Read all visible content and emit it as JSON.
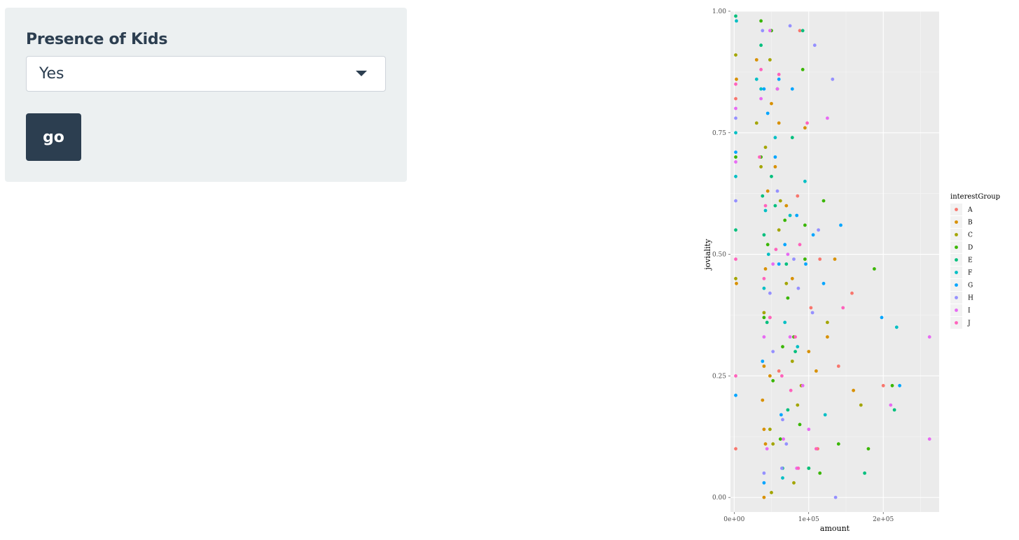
{
  "filter": {
    "label": "Presence of Kids",
    "selected": "Yes"
  },
  "go_button": {
    "label": "go"
  },
  "chart_data": {
    "type": "scatter",
    "xlabel": "amount",
    "ylabel": "joviality",
    "xlim": [
      -5000,
      275000
    ],
    "ylim": [
      -0.03,
      1.0
    ],
    "x_ticks": [
      0,
      100000,
      200000
    ],
    "x_tick_labels": [
      "0e+00",
      "1e+05",
      "2e+05"
    ],
    "y_ticks": [
      0,
      0.25,
      0.5,
      0.75,
      1.0
    ],
    "y_tick_labels": [
      "0.00",
      "0.25",
      "0.50",
      "0.75",
      "1.00"
    ],
    "grid": true,
    "legend": {
      "title": "interestGroup",
      "placement": "right"
    },
    "series": [
      {
        "name": "A",
        "color": "#F8766D",
        "points": [
          [
            2000,
            0.1
          ],
          [
            2000,
            0.82
          ],
          [
            88000,
            0.96
          ],
          [
            103000,
            0.39
          ],
          [
            112000,
            0.1
          ],
          [
            140000,
            0.27
          ],
          [
            158000,
            0.42
          ],
          [
            200000,
            0.23
          ],
          [
            48000,
            0.37
          ],
          [
            60000,
            0.26
          ],
          [
            85000,
            0.62
          ],
          [
            115000,
            0.49
          ]
        ]
      },
      {
        "name": "B",
        "color": "#D89000",
        "points": [
          [
            3000,
            0.44
          ],
          [
            3000,
            0.86
          ],
          [
            40000,
            0.0
          ],
          [
            40000,
            0.14
          ],
          [
            40000,
            0.27
          ],
          [
            42000,
            0.47
          ],
          [
            45000,
            0.63
          ],
          [
            50000,
            0.81
          ],
          [
            60000,
            0.77
          ],
          [
            70000,
            0.6
          ],
          [
            78000,
            0.45
          ],
          [
            95000,
            0.76
          ],
          [
            100000,
            0.3
          ],
          [
            110000,
            0.26
          ],
          [
            125000,
            0.33
          ],
          [
            135000,
            0.49
          ],
          [
            160000,
            0.22
          ],
          [
            42000,
            0.11
          ],
          [
            38000,
            0.2
          ],
          [
            48000,
            0.25
          ],
          [
            55000,
            0.68
          ],
          [
            30000,
            0.9
          ]
        ]
      },
      {
        "name": "C",
        "color": "#A3A500",
        "points": [
          [
            2000,
            0.45
          ],
          [
            2000,
            0.91
          ],
          [
            30000,
            0.77
          ],
          [
            36000,
            0.68
          ],
          [
            40000,
            0.38
          ],
          [
            42000,
            0.72
          ],
          [
            48000,
            0.14
          ],
          [
            50000,
            0.01
          ],
          [
            52000,
            0.11
          ],
          [
            58000,
            0.84
          ],
          [
            62000,
            0.61
          ],
          [
            70000,
            0.44
          ],
          [
            78000,
            0.28
          ],
          [
            85000,
            0.19
          ],
          [
            90000,
            0.23
          ],
          [
            125000,
            0.36
          ],
          [
            170000,
            0.19
          ],
          [
            48000,
            0.9
          ],
          [
            60000,
            0.55
          ],
          [
            80000,
            0.03
          ]
        ]
      },
      {
        "name": "D",
        "color": "#39B600",
        "points": [
          [
            2000,
            0.7
          ],
          [
            36000,
            0.98
          ],
          [
            40000,
            0.37
          ],
          [
            45000,
            0.52
          ],
          [
            50000,
            0.96
          ],
          [
            52000,
            0.24
          ],
          [
            62000,
            0.12
          ],
          [
            65000,
            0.31
          ],
          [
            72000,
            0.41
          ],
          [
            80000,
            0.33
          ],
          [
            88000,
            0.15
          ],
          [
            92000,
            0.88
          ],
          [
            95000,
            0.56
          ],
          [
            100000,
            0.06
          ],
          [
            115000,
            0.05
          ],
          [
            120000,
            0.61
          ],
          [
            140000,
            0.11
          ],
          [
            180000,
            0.1
          ],
          [
            212000,
            0.23
          ],
          [
            188000,
            0.47
          ],
          [
            36000,
            0.7
          ],
          [
            68000,
            0.57
          ],
          [
            95000,
            0.49
          ]
        ]
      },
      {
        "name": "E",
        "color": "#00BF7D",
        "points": [
          [
            2000,
            0.99
          ],
          [
            2000,
            0.55
          ],
          [
            36000,
            0.93
          ],
          [
            40000,
            0.54
          ],
          [
            44000,
            0.36
          ],
          [
            50000,
            0.66
          ],
          [
            55000,
            0.6
          ],
          [
            65000,
            0.06
          ],
          [
            72000,
            0.18
          ],
          [
            78000,
            0.74
          ],
          [
            82000,
            0.3
          ],
          [
            92000,
            0.96
          ],
          [
            100000,
            0.06
          ],
          [
            175000,
            0.05
          ],
          [
            215000,
            0.18
          ],
          [
            38000,
            0.62
          ],
          [
            70000,
            0.48
          ]
        ]
      },
      {
        "name": "F",
        "color": "#00BFC4",
        "points": [
          [
            2000,
            0.66
          ],
          [
            2000,
            0.75
          ],
          [
            3000,
            0.98
          ],
          [
            30000,
            0.86
          ],
          [
            40000,
            0.43
          ],
          [
            42000,
            0.59
          ],
          [
            46000,
            0.5
          ],
          [
            55000,
            0.74
          ],
          [
            65000,
            0.04
          ],
          [
            68000,
            0.36
          ],
          [
            75000,
            0.58
          ],
          [
            85000,
            0.31
          ],
          [
            95000,
            0.65
          ],
          [
            122000,
            0.17
          ],
          [
            218000,
            0.35
          ],
          [
            36000,
            0.84
          ]
        ]
      },
      {
        "name": "G",
        "color": "#00A5FF",
        "points": [
          [
            2000,
            0.71
          ],
          [
            2000,
            0.21
          ],
          [
            38000,
            0.28
          ],
          [
            40000,
            0.84
          ],
          [
            45000,
            0.79
          ],
          [
            55000,
            0.7
          ],
          [
            60000,
            0.48
          ],
          [
            63000,
            0.17
          ],
          [
            68000,
            0.52
          ],
          [
            78000,
            0.84
          ],
          [
            84000,
            0.58
          ],
          [
            96000,
            0.48
          ],
          [
            106000,
            0.54
          ],
          [
            120000,
            0.44
          ],
          [
            143000,
            0.56
          ],
          [
            198000,
            0.37
          ],
          [
            222000,
            0.23
          ],
          [
            40000,
            0.03
          ],
          [
            60000,
            0.86
          ]
        ]
      },
      {
        "name": "H",
        "color": "#9590FF",
        "points": [
          [
            2000,
            0.61
          ],
          [
            2000,
            0.78
          ],
          [
            38000,
            0.96
          ],
          [
            40000,
            0.05
          ],
          [
            48000,
            0.42
          ],
          [
            52000,
            0.3
          ],
          [
            58000,
            0.63
          ],
          [
            65000,
            0.16
          ],
          [
            70000,
            0.11
          ],
          [
            75000,
            0.97
          ],
          [
            80000,
            0.49
          ],
          [
            86000,
            0.43
          ],
          [
            105000,
            0.38
          ],
          [
            108000,
            0.93
          ],
          [
            113000,
            0.55
          ],
          [
            132000,
            0.86
          ],
          [
            136000,
            0.0
          ],
          [
            64000,
            0.06
          ]
        ]
      },
      {
        "name": "I",
        "color": "#E76BF3",
        "points": [
          [
            2000,
            0.69
          ],
          [
            2000,
            0.8
          ],
          [
            36000,
            0.82
          ],
          [
            40000,
            0.33
          ],
          [
            44000,
            0.1
          ],
          [
            48000,
            0.96
          ],
          [
            52000,
            0.48
          ],
          [
            66000,
            0.12
          ],
          [
            72000,
            0.5
          ],
          [
            84000,
            0.06
          ],
          [
            92000,
            0.23
          ],
          [
            100000,
            0.14
          ],
          [
            125000,
            0.78
          ],
          [
            210000,
            0.19
          ],
          [
            262000,
            0.33
          ],
          [
            262000,
            0.12
          ],
          [
            58000,
            0.84
          ],
          [
            75000,
            0.33
          ]
        ]
      },
      {
        "name": "J",
        "color": "#FF62BC",
        "points": [
          [
            2000,
            0.25
          ],
          [
            2000,
            0.49
          ],
          [
            2000,
            0.85
          ],
          [
            34000,
            0.7
          ],
          [
            40000,
            0.45
          ],
          [
            42000,
            0.6
          ],
          [
            48000,
            0.37
          ],
          [
            56000,
            0.51
          ],
          [
            64000,
            0.25
          ],
          [
            76000,
            0.22
          ],
          [
            82000,
            0.33
          ],
          [
            88000,
            0.52
          ],
          [
            98000,
            0.77
          ],
          [
            110000,
            0.1
          ],
          [
            146000,
            0.39
          ],
          [
            36000,
            0.88
          ],
          [
            86000,
            0.06
          ],
          [
            60000,
            0.87
          ]
        ]
      }
    ]
  }
}
